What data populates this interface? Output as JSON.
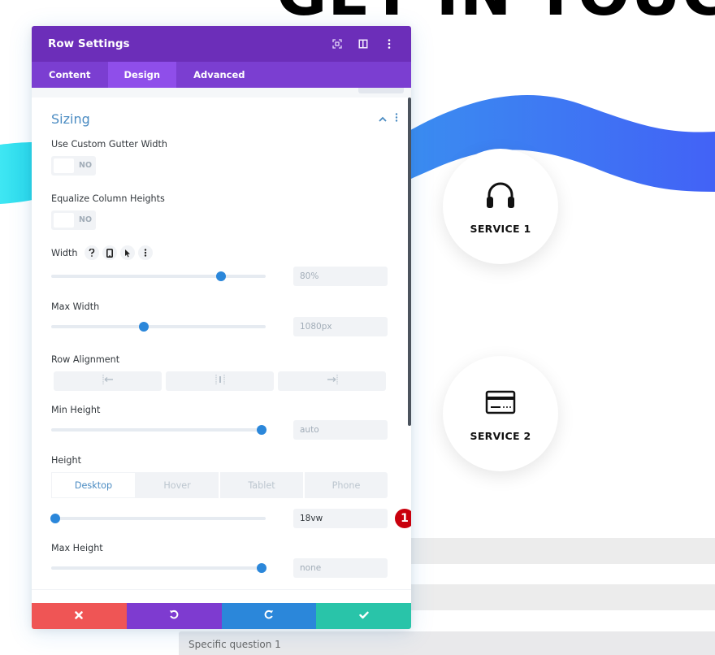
{
  "page": {
    "heading": "GET IN TOUCH",
    "services": [
      {
        "label": "SERVICE 1",
        "icon": "headphones-icon"
      },
      {
        "label": "SERVICE 2",
        "icon": "credit-card-icon"
      }
    ],
    "form": {
      "question_placeholder": "Specific question 1"
    },
    "colors": {
      "wave_start": "#3a8ff0",
      "wave_end": "#4262f6",
      "accent_left": "#2ee3ef"
    }
  },
  "modal": {
    "title": "Row Settings",
    "header_icons": [
      "fullscreen-icon",
      "split-view-icon",
      "more-options-icon"
    ],
    "tabs": [
      {
        "label": "Content",
        "active": false
      },
      {
        "label": "Design",
        "active": true
      },
      {
        "label": "Advanced",
        "active": false
      }
    ],
    "section": {
      "title": "Sizing",
      "expanded": true
    },
    "fields": {
      "custom_gutter": {
        "label": "Use Custom Gutter Width",
        "state": "NO"
      },
      "equalize_columns": {
        "label": "Equalize Column Heights",
        "state": "NO"
      },
      "width": {
        "label": "Width",
        "value": "80%",
        "slider_fraction": 0.79,
        "label_icons": [
          "help-icon",
          "responsive-phone-icon",
          "hover-cursor-icon",
          "more-icon"
        ]
      },
      "max_width": {
        "label": "Max Width",
        "value": "1080px",
        "slider_fraction": 0.43
      },
      "row_alignment": {
        "label": "Row Alignment",
        "options": [
          "align-left",
          "align-center",
          "align-right"
        ]
      },
      "min_height": {
        "label": "Min Height",
        "value": "auto",
        "slider_fraction": 0.98
      },
      "height": {
        "label": "Height",
        "device_tabs": [
          {
            "label": "Desktop",
            "active": true
          },
          {
            "label": "Hover",
            "active": false
          },
          {
            "label": "Tablet",
            "active": false
          },
          {
            "label": "Phone",
            "active": false
          }
        ],
        "value": "18vw",
        "slider_fraction": 0.02,
        "badge": "1"
      },
      "max_height": {
        "label": "Max Height",
        "value": "none",
        "slider_fraction": 0.98
      }
    },
    "footer": {
      "colors": {
        "cancel": "#ef5555",
        "undo": "#7e3bd0",
        "redo": "#2b87da",
        "save": "#29c4a9"
      }
    }
  }
}
